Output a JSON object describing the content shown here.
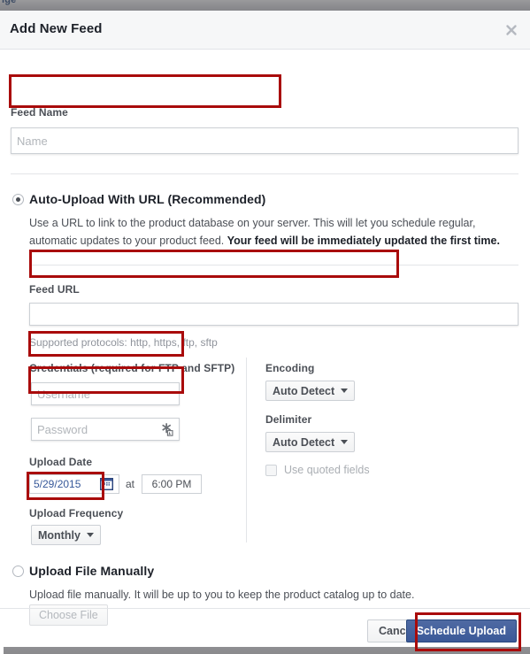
{
  "backdrop": {
    "fragment_text": "ige"
  },
  "dialog": {
    "title": "Add New Feed",
    "close_icon": "close-icon"
  },
  "feed_name": {
    "label": "Feed Name",
    "placeholder": "Name",
    "value": ""
  },
  "auto_upload": {
    "title": "Auto-Upload With URL (Recommended)",
    "description_plain": "Use a URL to link to the product database on your server. This will let you schedule regular, automatic updates to your product feed. ",
    "description_bold": "Your feed will be immediately updated the first time.",
    "selected": true
  },
  "feed_url": {
    "label": "Feed URL",
    "placeholder": "",
    "value": "",
    "help_text": "Supported protocols: http, https, ftp, sftp"
  },
  "credentials": {
    "label": "Credentials (required for FTP and SFTP)",
    "username_placeholder": "Username",
    "username_value": "",
    "password_placeholder": "Password",
    "password_value": "",
    "password_icon": "key-icon"
  },
  "upload_date": {
    "label": "Upload Date",
    "date_value": "5/29/2015",
    "calendar_icon": "calendar-icon",
    "at_text": "at",
    "time_value": "6:00 PM"
  },
  "upload_frequency": {
    "label": "Upload Frequency",
    "selected": "Monthly"
  },
  "encoding": {
    "label": "Encoding",
    "selected": "Auto Detect"
  },
  "delimiter": {
    "label": "Delimiter",
    "selected": "Auto Detect"
  },
  "quoted_fields": {
    "label": "Use quoted fields",
    "checked": false
  },
  "manual_upload": {
    "title": "Upload File Manually",
    "description": "Upload file manually. It will be up to you to keep the product catalog up to date.",
    "choose_file_label": "Choose File",
    "selected": false
  },
  "footer": {
    "cancel_label": "Cancel",
    "submit_label": "Schedule Upload"
  },
  "colors": {
    "annotation": "#a90b0b",
    "primary_button": "#3b5998",
    "primary_button_border": "#29487d",
    "link_text": "#365899",
    "header_bg": "#f6f7f8"
  }
}
